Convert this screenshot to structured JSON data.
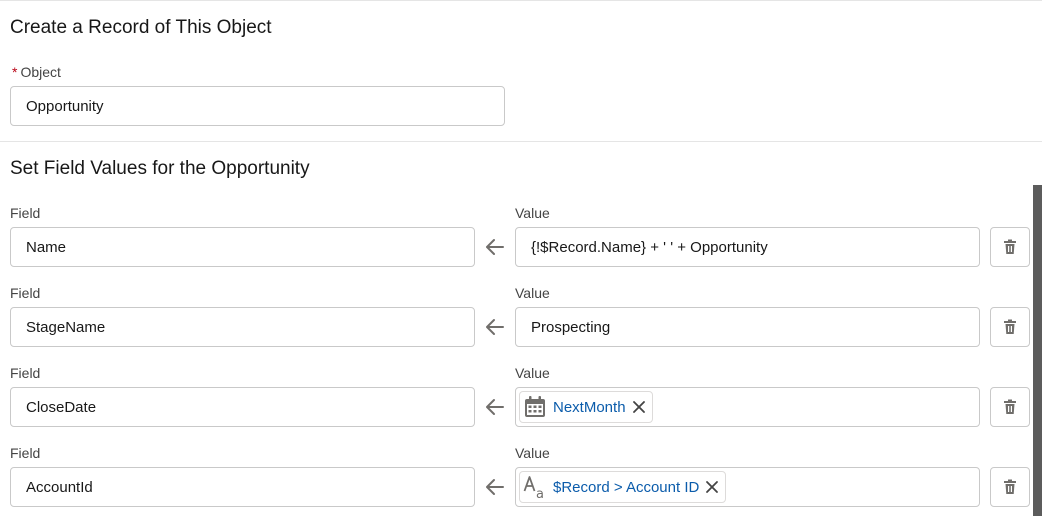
{
  "create_section": {
    "title": "Create a Record of This Object",
    "object_label": "Object",
    "object_value": "Opportunity"
  },
  "field_values_section": {
    "title": "Set Field Values for the Opportunity",
    "field_header": "Field",
    "value_header": "Value",
    "rows": [
      {
        "field": "Name",
        "value": "{!$Record.Name} + ' ' + Opportunity"
      },
      {
        "field": "StageName",
        "value": "Prospecting"
      },
      {
        "field": "CloseDate",
        "value_pill": {
          "label": "NextMonth",
          "icon": "calendar-icon"
        }
      },
      {
        "field": "AccountId",
        "value_pill": {
          "label": "$Record > Account ID",
          "icon": "text-type-icon"
        }
      }
    ]
  },
  "colors": {
    "accent": "#0b5cab",
    "required": "#ba0517",
    "icon": "#706e6b",
    "border": "#c9c9c9"
  }
}
